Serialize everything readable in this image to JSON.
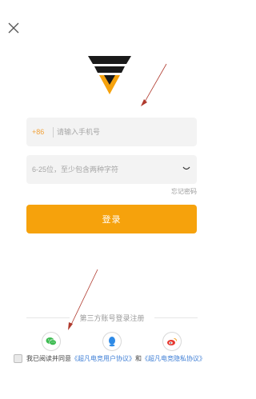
{
  "icons": {
    "close": "close-icon",
    "logo": "brand-logo",
    "eye": "eye-closed-icon",
    "wechat": "wechat-icon",
    "qq": "qq-icon",
    "weibo": "weibo-icon"
  },
  "colors": {
    "accent": "#f6a20c",
    "link": "#3f7fd6",
    "field_bg": "#f3f3f3",
    "annotation": "#b03a2e"
  },
  "login": {
    "country_code": "+86",
    "phone_placeholder": "请输入手机号",
    "password_placeholder": "6-25位，至少包含两种字符",
    "forgot_password": "忘记密码",
    "login_button": "登录"
  },
  "third_party": {
    "label": "第三方账号登录注册"
  },
  "agreement": {
    "prefix": "我已阅读并同意",
    "user_agreement": "《超凡电竞用户协议》",
    "and": "和",
    "privacy_agreement": "《超凡电竞隐私协议》"
  }
}
